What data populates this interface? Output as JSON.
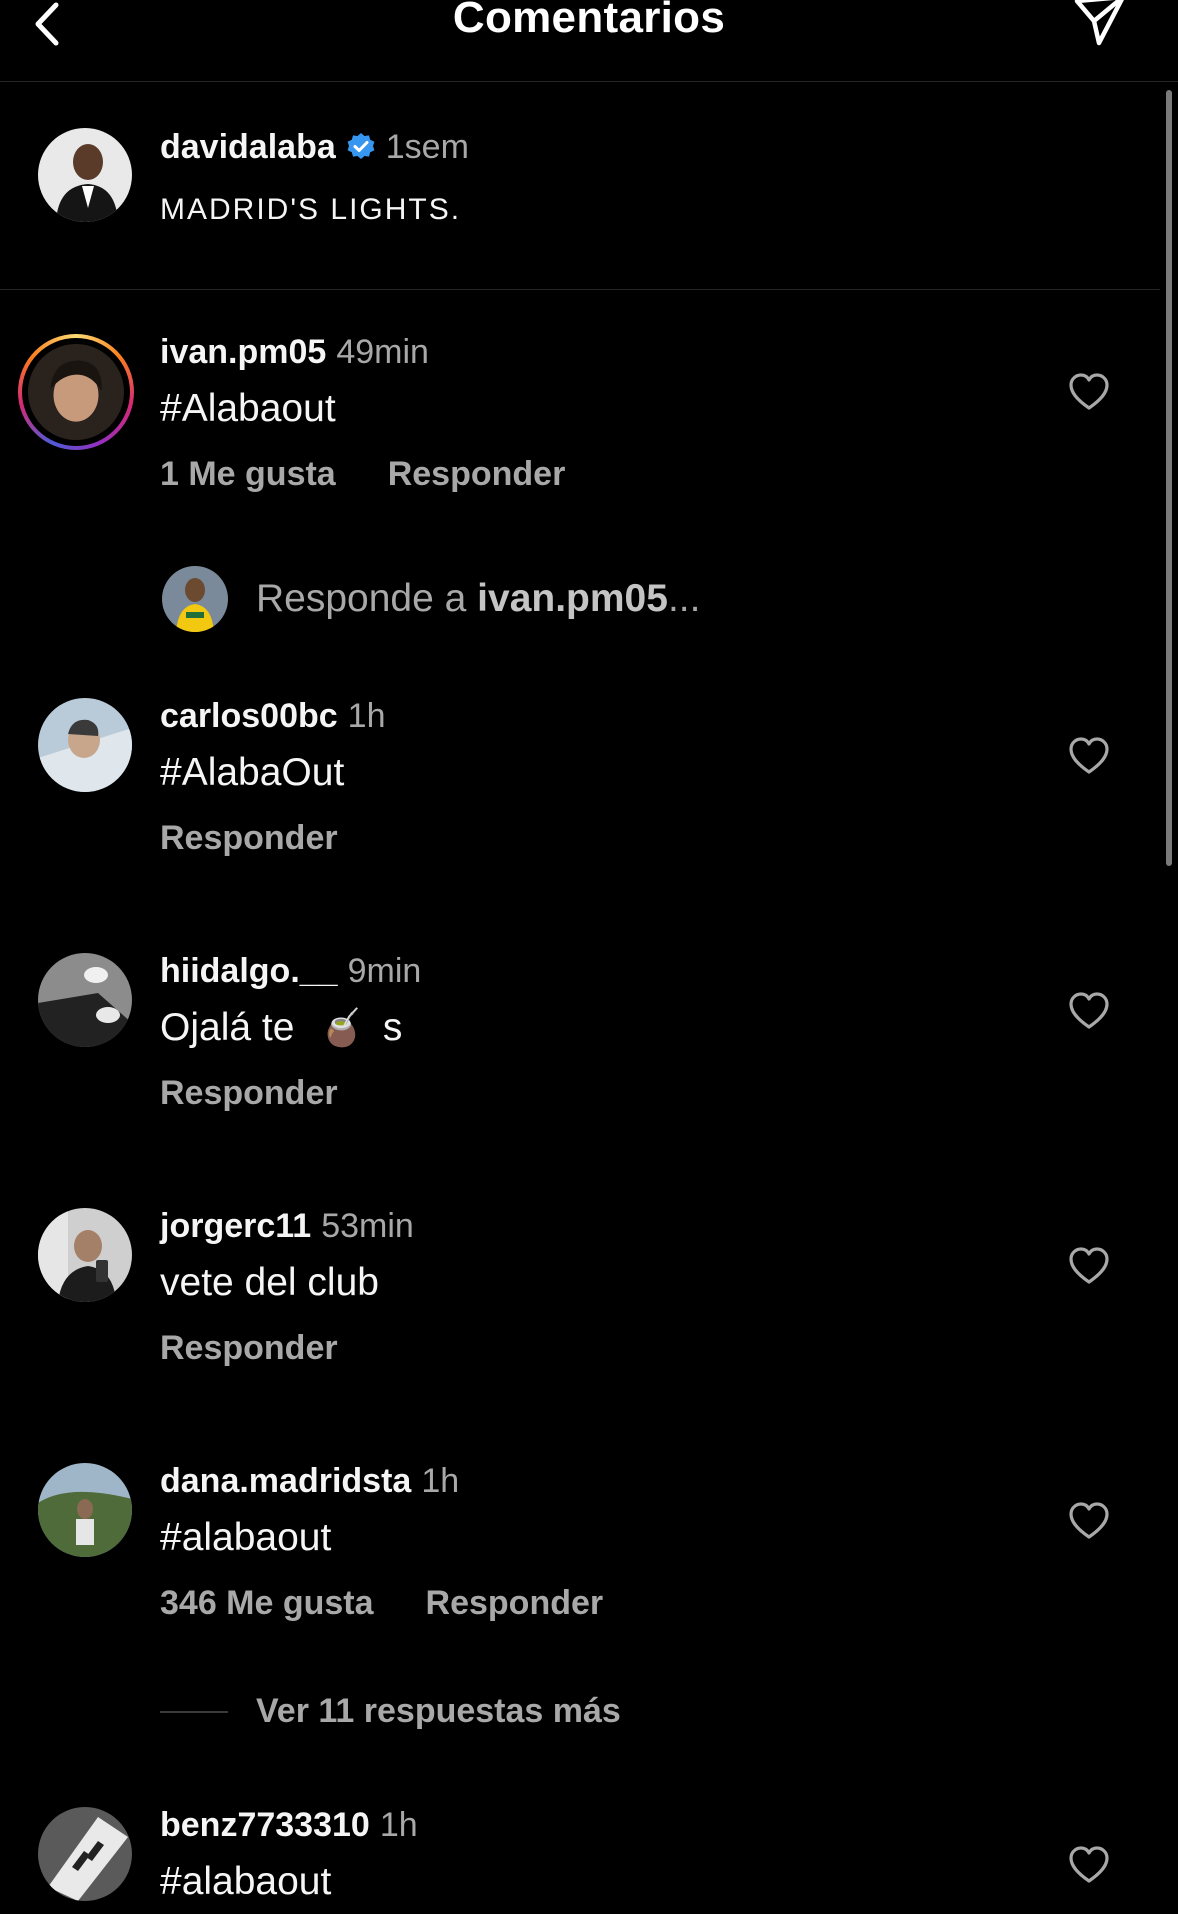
{
  "header": {
    "title": "Comentarios",
    "back_icon": "chevron-left-icon",
    "share_icon": "paper-plane-icon"
  },
  "caption": {
    "username": "davidalaba",
    "verified": true,
    "time": "1sem",
    "text": "MADRID'S LIGHTS."
  },
  "comments": [
    {
      "username": "ivan.pm05",
      "time": "49min",
      "text": "#Alabaout",
      "likes": "1 Me gusta",
      "reply": "Responder",
      "has_story": true
    },
    {
      "username": "carlos00bc",
      "time": "1h",
      "text": "#AlabaOut",
      "likes": "",
      "reply": "Responder"
    },
    {
      "username": "hiidalgo.__",
      "time": "9min",
      "text_before": "Ojalá te",
      "emoji": "🧉",
      "text_after": "s",
      "likes": "",
      "reply": "Responder"
    },
    {
      "username": "jorgerc11",
      "time": "53min",
      "text": "vete del club",
      "likes": "",
      "reply": "Responder"
    },
    {
      "username": "dana.madridsta",
      "time": "1h",
      "text": "#alabaout",
      "likes": "346 Me gusta",
      "reply": "Responder"
    },
    {
      "username": "benz7733310",
      "time": "1h",
      "text": "#alabaout"
    }
  ],
  "reply_field": {
    "prefix": "Responde a ",
    "target": "ivan.pm05",
    "suffix": "..."
  },
  "more_replies": "Ver 11 respuestas más",
  "colors": {
    "background": "#000000",
    "text": "#f5f5f5",
    "secondary": "#a8a8a8",
    "verified": "#3797f0",
    "divider": "#262626"
  }
}
